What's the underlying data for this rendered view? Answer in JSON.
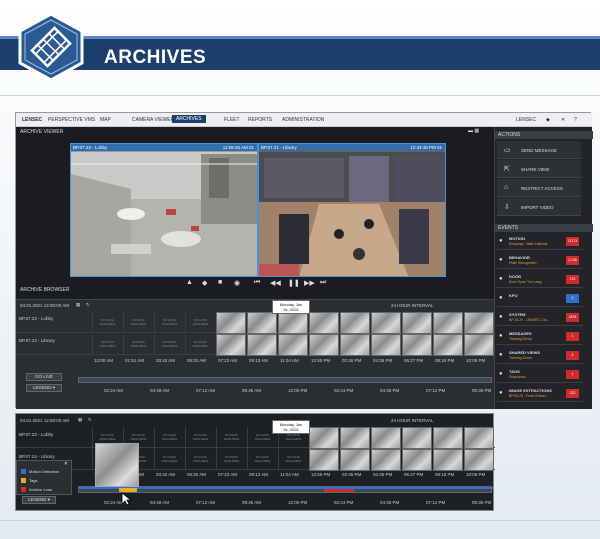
{
  "header": {
    "title": "ARCHIVES"
  },
  "nav": {
    "brand": "LENSEC",
    "product": "PERSPECTIVE VMS",
    "items": [
      "MAP",
      "CAMERA VIEWER",
      "ARCHIVES",
      "FLEET",
      "REPORTS",
      "ADMINISTRATION"
    ],
    "user": "LENSEC"
  },
  "viewer": {
    "title": "ARCHIVE VIEWER",
    "browser_label": "ARCHIVE BROWSER",
    "cam1": {
      "name": "BP.07.23 - Lobby",
      "time": "11:06:46 AM 01"
    },
    "cam2": {
      "name": "BP.07.21 - Library",
      "time": "12:34:48 PM 01"
    }
  },
  "timeline1": {
    "date": "04.01.2021  12:00:00 AM",
    "interval": "24 HOUR INTERVAL",
    "rows": [
      {
        "name": "BP.07.23 - Lobby",
        "sub": "- Lobby"
      },
      {
        "name": "BP.07.24 - Library",
        "sub": "- Library"
      }
    ],
    "no_data": "NO DATA AVAILABLE",
    "tooltip": {
      "day": "Monday, Jan",
      "date": "04, 2021"
    },
    "top_ticks": [
      "12:00 AM",
      "01:51 AM",
      "03:42 AM",
      "05:32 AM",
      "07:23 AM",
      "09:13 AM",
      "11:04 AM",
      "12:55 PM",
      "02:46 PM",
      "04:36 PM",
      "06:27 PM",
      "08:18 PM",
      "10:09 PM"
    ],
    "bottom_ticks": [
      "02:24 AM",
      "04:48 AM",
      "07:12 AM",
      "09:36 AM",
      "12:00 PM",
      "02:24 PM",
      "04:48 PM",
      "07:12 PM",
      "09:36 PM"
    ],
    "go_live": "GO LIVE",
    "legend": "LEGEND ▾"
  },
  "timeline2": {
    "date": "04.01.2021  12:00:00 AM",
    "interval": "24 HOUR INTERVAL",
    "rows": [
      {
        "name": "BP.07.23 - Lobby"
      },
      {
        "name": "BP.07.24 - Library"
      }
    ],
    "tooltip": {
      "day": "Monday, Jan",
      "date": "04, 2021"
    },
    "top_ticks": [
      "12:00 AM",
      "01:51 AM",
      "03:42 AM",
      "05:32 AM",
      "07:23 AM",
      "09:13 AM",
      "11:04 AM",
      "12:55 PM",
      "02:46 PM",
      "04:36 PM",
      "06:27 PM",
      "08:18 PM",
      "10:09 PM"
    ],
    "bottom_ticks": [
      "02:24 AM",
      "04:48 AM",
      "07:12 AM",
      "09:36 AM",
      "12:00 PM",
      "02:24 PM",
      "04:48 PM",
      "07:12 PM",
      "09:36 PM"
    ],
    "legend_items": [
      {
        "label": "Motion Detection",
        "color": "#2f6fd0"
      },
      {
        "label": "Tags",
        "color": "#e8b020"
      },
      {
        "label": "Archive Loss",
        "color": "#d02a2a"
      }
    ],
    "legend": "LEGEND ▾"
  },
  "actions": {
    "title": "ACTIONS",
    "items": [
      "SEND MESSAGE",
      "SHARE VIEW",
      "RESTRICT ACCESS",
      "IMPORT VIDEO"
    ]
  },
  "events": {
    "title": "EVENTS",
    "items": [
      {
        "title": "MOTION",
        "sub": "Entryway - Main Hallway",
        "count": "11173",
        "color": "#d02a2a"
      },
      {
        "title": "BEHAVIOR",
        "sub": "Plate Recognition",
        "count": "2,106",
        "color": "#d02a2a"
      },
      {
        "title": "DOOR",
        "sub": "Door Open Too Long",
        "count": "132",
        "color": "#d02a2a"
      },
      {
        "title": "KPO",
        "sub": "",
        "count": "0",
        "color": "#2f6fd0"
      },
      {
        "title": "SYSTEM",
        "sub": "BP.19.29 - LENSEC Cor...",
        "count": "2493",
        "color": "#d02a2a"
      },
      {
        "title": "MESSAGES",
        "sub": "Training Demo",
        "count": "1",
        "color": "#d02a2a"
      },
      {
        "title": "SHARED VIEWS",
        "sub": "Training Demo",
        "count": "4",
        "color": "#d02a2a"
      },
      {
        "title": "TAGS",
        "sub": "Suspicious",
        "count": "1",
        "color": "#d02a2a"
      },
      {
        "title": "IMAGE EXTRACTIONS",
        "sub": "BP.09.23 - Front Entran...",
        "count": "222",
        "color": "#d02a2a"
      }
    ]
  }
}
